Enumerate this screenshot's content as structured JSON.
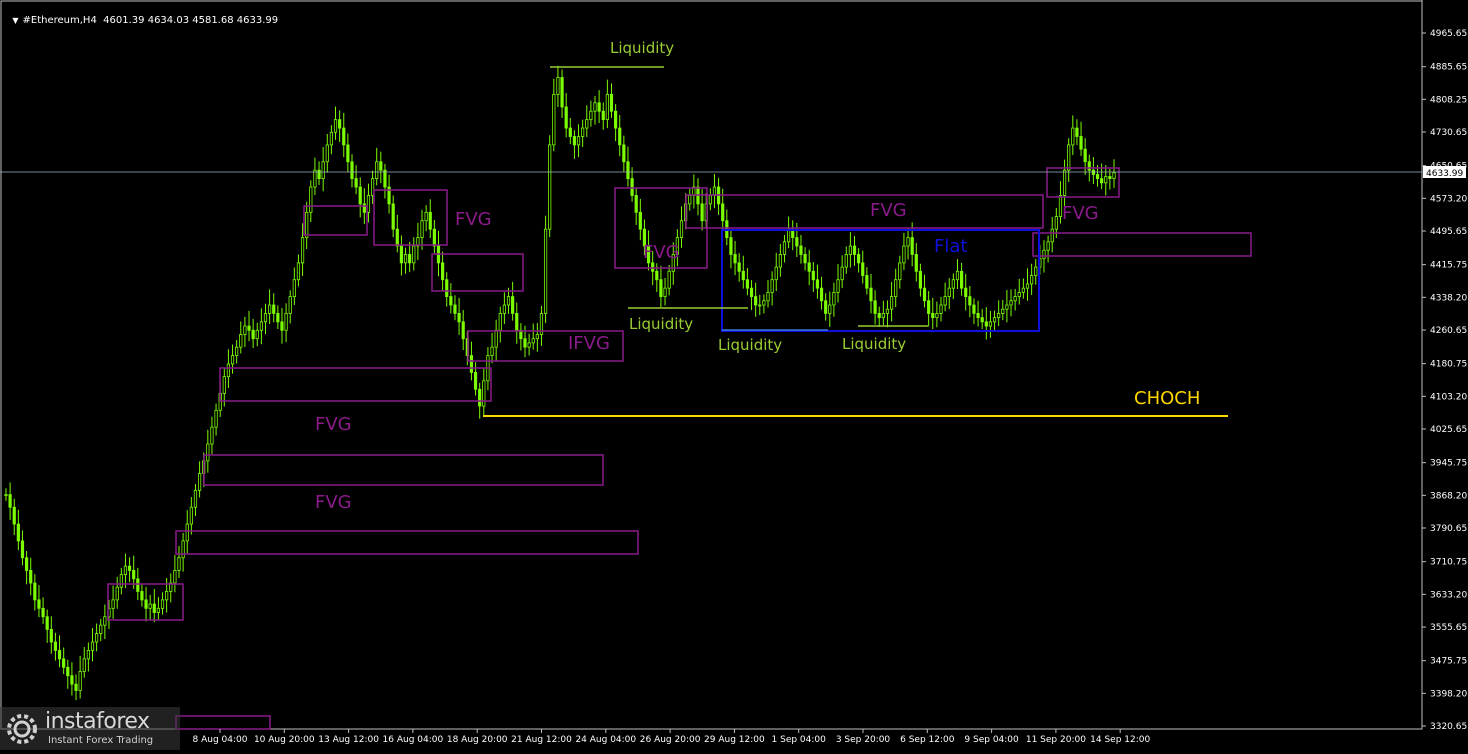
{
  "header": {
    "symbol": "#Ethereum,H4",
    "ohlc": "4601.39 4634.03 4581.68 4633.99"
  },
  "logo": {
    "brand": "instaforex",
    "tagline": "Instant Forex Trading"
  },
  "colors": {
    "background": "#000000",
    "candle": "#7cfc00",
    "zone": "#8b1a8b",
    "zone_label": "#8b1a8b",
    "liquidity": "#9acd32",
    "flat_box": "#1010dd",
    "choch": "#ffd700",
    "axis": "#ffffff",
    "price_line": "#9fb7c8"
  },
  "chart_data": {
    "type": "candlestick",
    "title": "",
    "ylim": [
      3280,
      5020
    ],
    "y_ticks": [
      "4965.65",
      "4885.65",
      "4808.25",
      "4730.65",
      "4650.65",
      "4573.20",
      "4495.65",
      "4415.75",
      "4338.20",
      "4260.65",
      "4180.75",
      "4103.20",
      "4025.65",
      "3945.75",
      "3868.20",
      "3790.65",
      "3710.75",
      "3633.20",
      "3555.65",
      "3475.75",
      "3398.20",
      "3320.65"
    ],
    "x_ticks": [
      "8 Aug 04:00",
      "10 Aug 20:00",
      "13 Aug 12:00",
      "16 Aug 04:00",
      "18 Aug 20:00",
      "21 Aug 12:00",
      "24 Aug 04:00",
      "26 Aug 20:00",
      "29 Aug 12:00",
      "1 Sep 04:00",
      "3 Sep 20:00",
      "6 Sep 12:00",
      "9 Sep 04:00",
      "11 Sep 20:00",
      "14 Sep 12:00"
    ],
    "current_price": "4633.99",
    "series": [
      {
        "close": [
          3870,
          3840,
          3800,
          3760,
          3720,
          3690,
          3660,
          3620,
          3600,
          3580,
          3550,
          3520,
          3500,
          3480,
          3460,
          3440,
          3420,
          3405,
          3450,
          3480,
          3500,
          3520,
          3540,
          3560,
          3580,
          3600,
          3620,
          3650,
          3680,
          3700,
          3690,
          3670,
          3640,
          3620,
          3600,
          3610,
          3590,
          3600,
          3620,
          3640,
          3660,
          3690,
          3720,
          3760,
          3800,
          3840,
          3880,
          3920,
          3950,
          3990,
          4030,
          4070,
          4110,
          4150,
          4180,
          4200,
          4220,
          4250,
          4270,
          4260,
          4240,
          4260,
          4280,
          4300,
          4320,
          4300,
          4280,
          4260,
          4300,
          4340,
          4380,
          4420,
          4480,
          4540,
          4600,
          4640,
          4620,
          4660,
          4700,
          4730,
          4760,
          4740,
          4700,
          4660,
          4620,
          4600,
          4560,
          4540,
          4580,
          4620,
          4660,
          4640,
          4600,
          4560,
          4500,
          4460,
          4420,
          4440,
          4420,
          4460,
          4480,
          4520,
          4540,
          4500,
          4460,
          4420,
          4380,
          4340,
          4320,
          4300,
          4280,
          4240,
          4200,
          4160,
          4120,
          4080,
          4140,
          4200,
          4220,
          4260,
          4300,
          4320,
          4340,
          4300,
          4260,
          4240,
          4220,
          4230,
          4240,
          4250,
          4300,
          4500,
          4700,
          4820,
          4860,
          4790,
          4740,
          4720,
          4700,
          4720,
          4740,
          4760,
          4780,
          4800,
          4780,
          4760,
          4820,
          4780,
          4740,
          4700,
          4660,
          4620,
          4580,
          4540,
          4500,
          4460,
          4420,
          4400,
          4380,
          4340,
          4360,
          4400,
          4440,
          4480,
          4520,
          4560,
          4580,
          4600,
          4560,
          4520,
          4560,
          4580,
          4600,
          4560,
          4520,
          4480,
          4440,
          4420,
          4400,
          4380,
          4360,
          4340,
          4320,
          4320,
          4330,
          4350,
          4380,
          4410,
          4440,
          4470,
          4500,
          4480,
          4460,
          4440,
          4420,
          4400,
          4380,
          4360,
          4330,
          4300,
          4320,
          4350,
          4380,
          4410,
          4440,
          4460,
          4440,
          4420,
          4390,
          4360,
          4330,
          4300,
          4290,
          4300,
          4310,
          4340,
          4380,
          4420,
          4460,
          4480,
          4440,
          4400,
          4360,
          4330,
          4300,
          4290,
          4300,
          4320,
          4340,
          4360,
          4380,
          4400,
          4360,
          4340,
          4320,
          4300,
          4290,
          4280,
          4270,
          4280,
          4290,
          4300,
          4310,
          4320,
          4330,
          4340,
          4350,
          4360,
          4370,
          4390,
          4410,
          4430,
          4450,
          4470,
          4500,
          4530,
          4580,
          4640,
          4700,
          4740,
          4720,
          4690,
          4660,
          4640,
          4630,
          4620,
          4610,
          4625,
          4620,
          4634
        ]
      }
    ],
    "zones": [
      {
        "label": "FVG",
        "kind": "fvg"
      },
      {
        "label": "FVG",
        "kind": "fvg"
      },
      {
        "label": "IFVG",
        "kind": "fvg"
      },
      {
        "label": "FVG",
        "kind": "fvg"
      },
      {
        "label": "FVG",
        "kind": "fvg"
      },
      {
        "label": "FVG",
        "kind": "fvg"
      },
      {
        "label": "FVG",
        "kind": "fvg"
      }
    ],
    "annotations": {
      "liquidity_top": "Liquidity",
      "liquidity_1": "Liquidity",
      "liquidity_2": "Liquidity",
      "liquidity_3": "Liquidity",
      "fvg_1": "FVG",
      "fvg_2": "FVG",
      "fvg_3": "FVG",
      "fvg_4": "FVG",
      "fvg_5": "FVG",
      "fvg_6": "FVG",
      "ifvg": "IFVG",
      "flat": "Flat",
      "choch": "CHOCH"
    }
  }
}
